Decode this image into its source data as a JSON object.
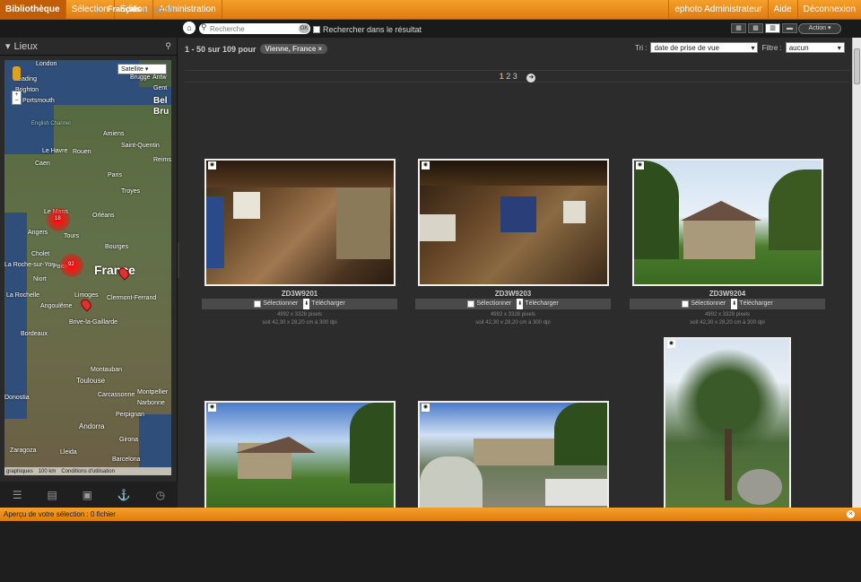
{
  "topbar": {
    "tabs": [
      "Bibliothèque",
      "Sélection",
      "Édition",
      "Administration"
    ],
    "user": "ephoto Administrateur",
    "help": "Aide",
    "logout": "Déconnexion"
  },
  "lang": {
    "active": "Français",
    "sep": "|",
    "other": "English"
  },
  "search": {
    "placeholder": "Recherche",
    "ok": "OK",
    "refine": "Rechercher dans le résultat"
  },
  "action": "Action",
  "sidebar": {
    "title": "Lieux",
    "maptype": "Satellite",
    "map_labels": [
      "London",
      "Brugge",
      "Antw",
      "Gent",
      "Reading",
      "Brighton",
      "Portsmouth",
      "English Channel",
      "Amiens",
      "Saint-Quentin",
      "Bel",
      "Bru",
      "Le Havre",
      "Rouen",
      "Caen",
      "Reims",
      "Paris",
      "Troyes",
      "Le Mans",
      "Orléans",
      "Angers",
      "Tours",
      "Cholet",
      "Bourges",
      "La Roche-sur-Yon",
      "France",
      "Poitiers",
      "Niort",
      "La Rochelle",
      "Limoges",
      "Clermont-Ferrand",
      "Angoulême",
      "Brive-la-Gaillarde",
      "Bordeaux",
      "Montauban",
      "Toulouse",
      "Carcassonne",
      "Montpellier",
      "Perpignan",
      "Narbonne",
      "Andorra",
      "Donostia",
      "Girona",
      "Zaragoza",
      "Lleida",
      "Barcelona"
    ],
    "hot1": "18",
    "hot2": "92",
    "footer_left": "graphiques",
    "scale": "100 km",
    "terms": "Conditions d'utilisation"
  },
  "main": {
    "result_text": "1 - 50 sur 109 pour",
    "tag": "Vienne, France ×",
    "sort_label": "Tri :",
    "sort_value": "date de prise de vue",
    "filter_label": "Filtre :",
    "filter_value": "aucun",
    "pages": [
      "1",
      "2",
      "3"
    ]
  },
  "cards": [
    {
      "name": "ZD3W9201",
      "select": "Sélectionner",
      "download": "Télécharger",
      "size": "4992 x 3328 pixels",
      "res": "soit 42,30 x 28,20 cm à 300 dpi"
    },
    {
      "name": "ZD3W9203",
      "select": "Sélectionner",
      "download": "Télécharger",
      "size": "4992 x 3328 pixels",
      "res": "soit 42,30 x 28,20 cm à 300 dpi"
    },
    {
      "name": "ZD3W9204",
      "select": "Sélectionner",
      "download": "Télécharger",
      "size": "4992 x 3328 pixels",
      "res": "soit 42,30 x 28,20 cm à 300 dpi"
    }
  ],
  "bottombar": {
    "text": "Aperçu de votre sélection : 0 fichier"
  }
}
